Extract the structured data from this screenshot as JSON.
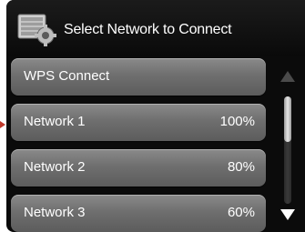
{
  "header": {
    "title": "Select Network to Connect",
    "icon": "network-settings-icon"
  },
  "list": {
    "items": [
      {
        "label": "WPS Connect",
        "signal": ""
      },
      {
        "label": "Network 1",
        "signal": "100%"
      },
      {
        "label": "Network 2",
        "signal": "80%"
      },
      {
        "label": "Network 3",
        "signal": "60%"
      }
    ]
  },
  "scrollbar": {
    "up_icon": "arrow-up-icon",
    "down_icon": "arrow-down-icon",
    "position": 0
  },
  "colors": {
    "background": "#0b0b0b",
    "row": "#6f6f6f",
    "text": "#ffffff",
    "pointer": "#c0392b"
  }
}
